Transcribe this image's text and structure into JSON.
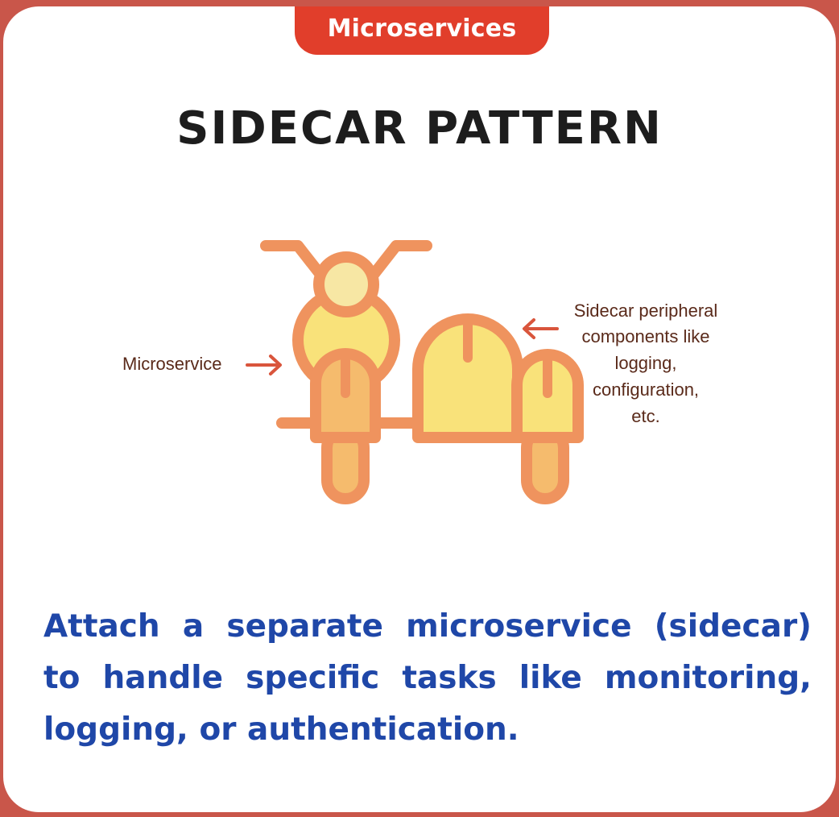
{
  "header": {
    "tag": "Microservices",
    "title": "SIDECAR PATTERN"
  },
  "diagram": {
    "microservice_label": "Microservice",
    "sidecar_label_lines": [
      "Sidecar peripheral",
      "components like",
      "logging,",
      "configuration,",
      "etc."
    ],
    "colors": {
      "outline": "#ef935e",
      "fill_light": "#f9e27a",
      "fill_rider": "#f5bb6d",
      "head_fill": "#f7e7a4",
      "arrow": "#d9553c",
      "label_text": "#5a2a1a"
    }
  },
  "description": "Attach a separate microservice (sidecar) to handle specific tasks like monitoring, logging, or authentication.",
  "colors": {
    "tag_bg": "#e13e2b",
    "title_text": "#1d1d1d",
    "description_text": "#1f47a8",
    "page_border": "#c9564a"
  }
}
